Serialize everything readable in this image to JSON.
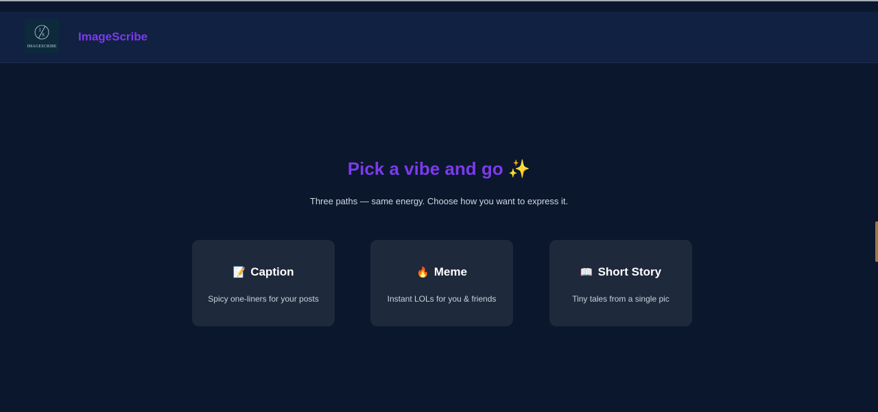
{
  "header": {
    "logo_text": "IMAGESCRIBE",
    "logo_icon": "i-s-monogram-icon",
    "brand": "ImageScribe"
  },
  "hero": {
    "title": "Pick a vibe and go ✨",
    "subtitle": "Three paths — same energy. Choose how you want to express it."
  },
  "cards": [
    {
      "icon": "📝",
      "icon_name": "memo-icon",
      "title": "Caption",
      "description": "Spicy one-liners for your posts"
    },
    {
      "icon": "🔥",
      "icon_name": "fire-icon",
      "title": "Meme",
      "description": "Instant LOLs for you & friends"
    },
    {
      "icon": "📖",
      "icon_name": "open-book-icon",
      "title": "Short Story",
      "description": "Tiny tales from a single pic"
    }
  ],
  "colors": {
    "background": "#0b172d",
    "header": "#112141",
    "accent": "#7c3aed",
    "card": "#1e293b",
    "side_tab": "#9a7b45"
  }
}
